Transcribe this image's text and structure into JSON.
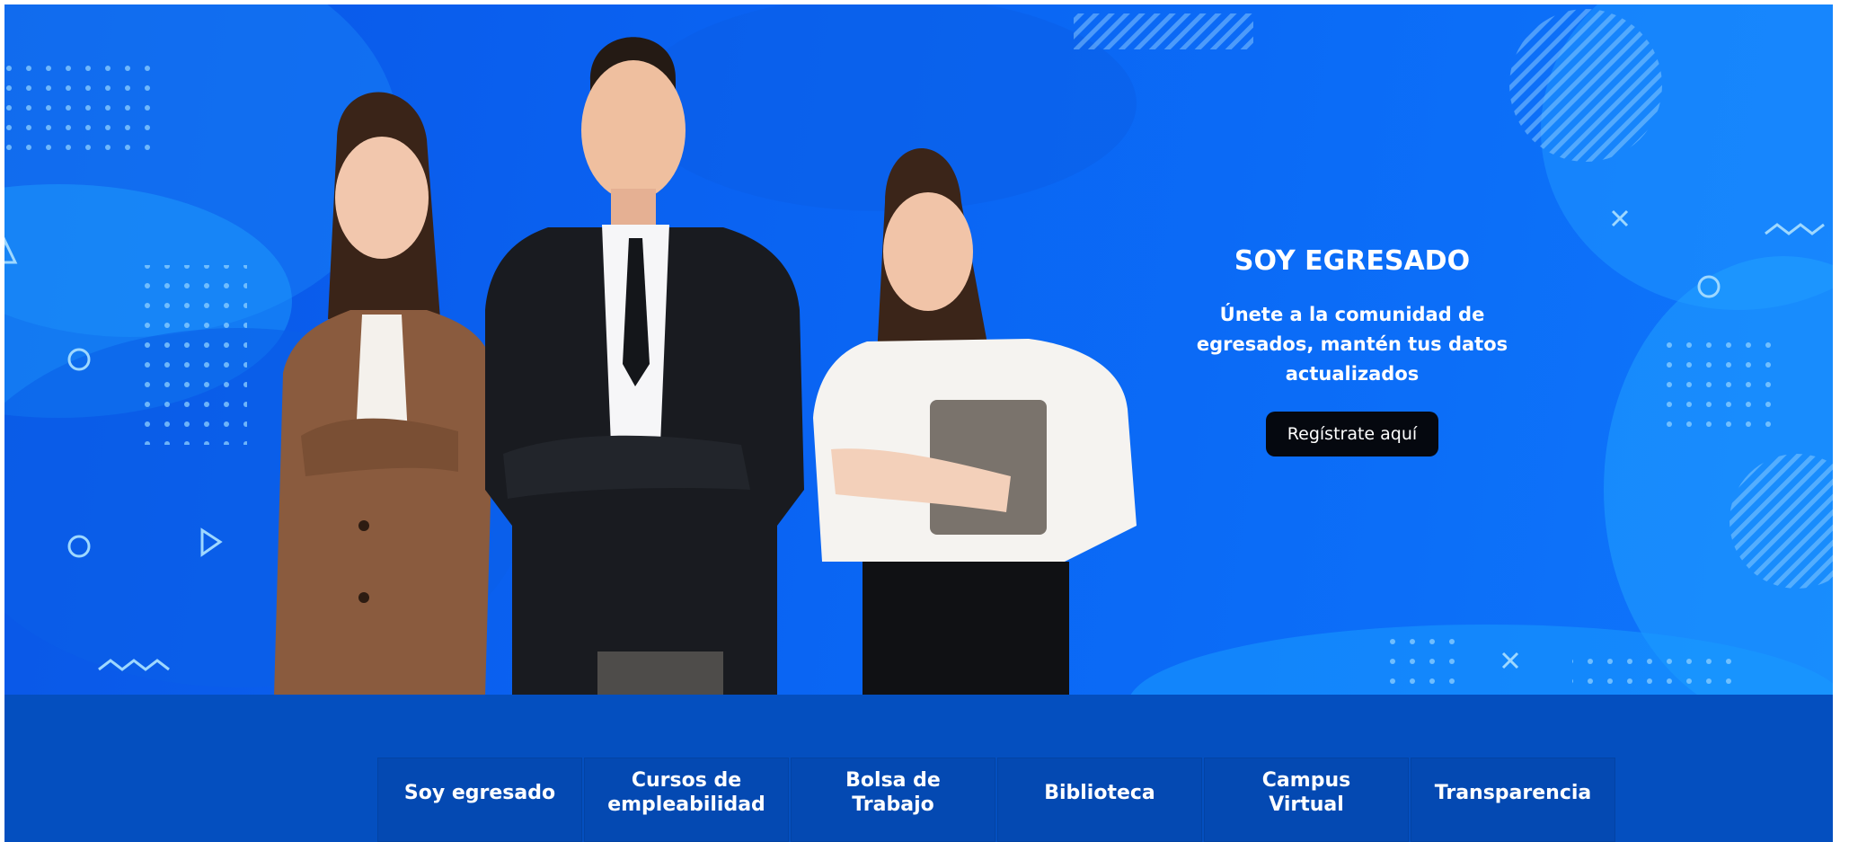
{
  "hero": {
    "title": "SOY EGRESADO",
    "subtitle_lines": [
      "Únete a la comunidad de",
      "egresados, mantén tus datos",
      "actualizados"
    ],
    "cta_label": "Regístrate aquí",
    "colors": {
      "background": "#0a63f2",
      "cta_background": "#05080f",
      "text": "#ffffff"
    },
    "decorations": [
      "dot-grid-icon",
      "circle-outline-icon",
      "triangle-outline-icon",
      "x-mark-icon",
      "wave-icon",
      "stripe-circle-icon"
    ]
  },
  "nav": {
    "items": [
      {
        "id": "soy-egresado",
        "lines": [
          "Soy egresado"
        ]
      },
      {
        "id": "cursos-empleabilidad",
        "lines": [
          "Cursos de",
          "empleabilidad"
        ]
      },
      {
        "id": "bolsa-trabajo",
        "lines": [
          "Bolsa de",
          "Trabajo"
        ]
      },
      {
        "id": "biblioteca",
        "lines": [
          "Biblioteca"
        ]
      },
      {
        "id": "campus-virtual",
        "lines": [
          "Campus",
          "Virtual"
        ]
      },
      {
        "id": "transparencia",
        "lines": [
          "Transparencia"
        ]
      }
    ],
    "colors": {
      "section_background": "#044fbf",
      "card_background": "#0449b2"
    }
  }
}
